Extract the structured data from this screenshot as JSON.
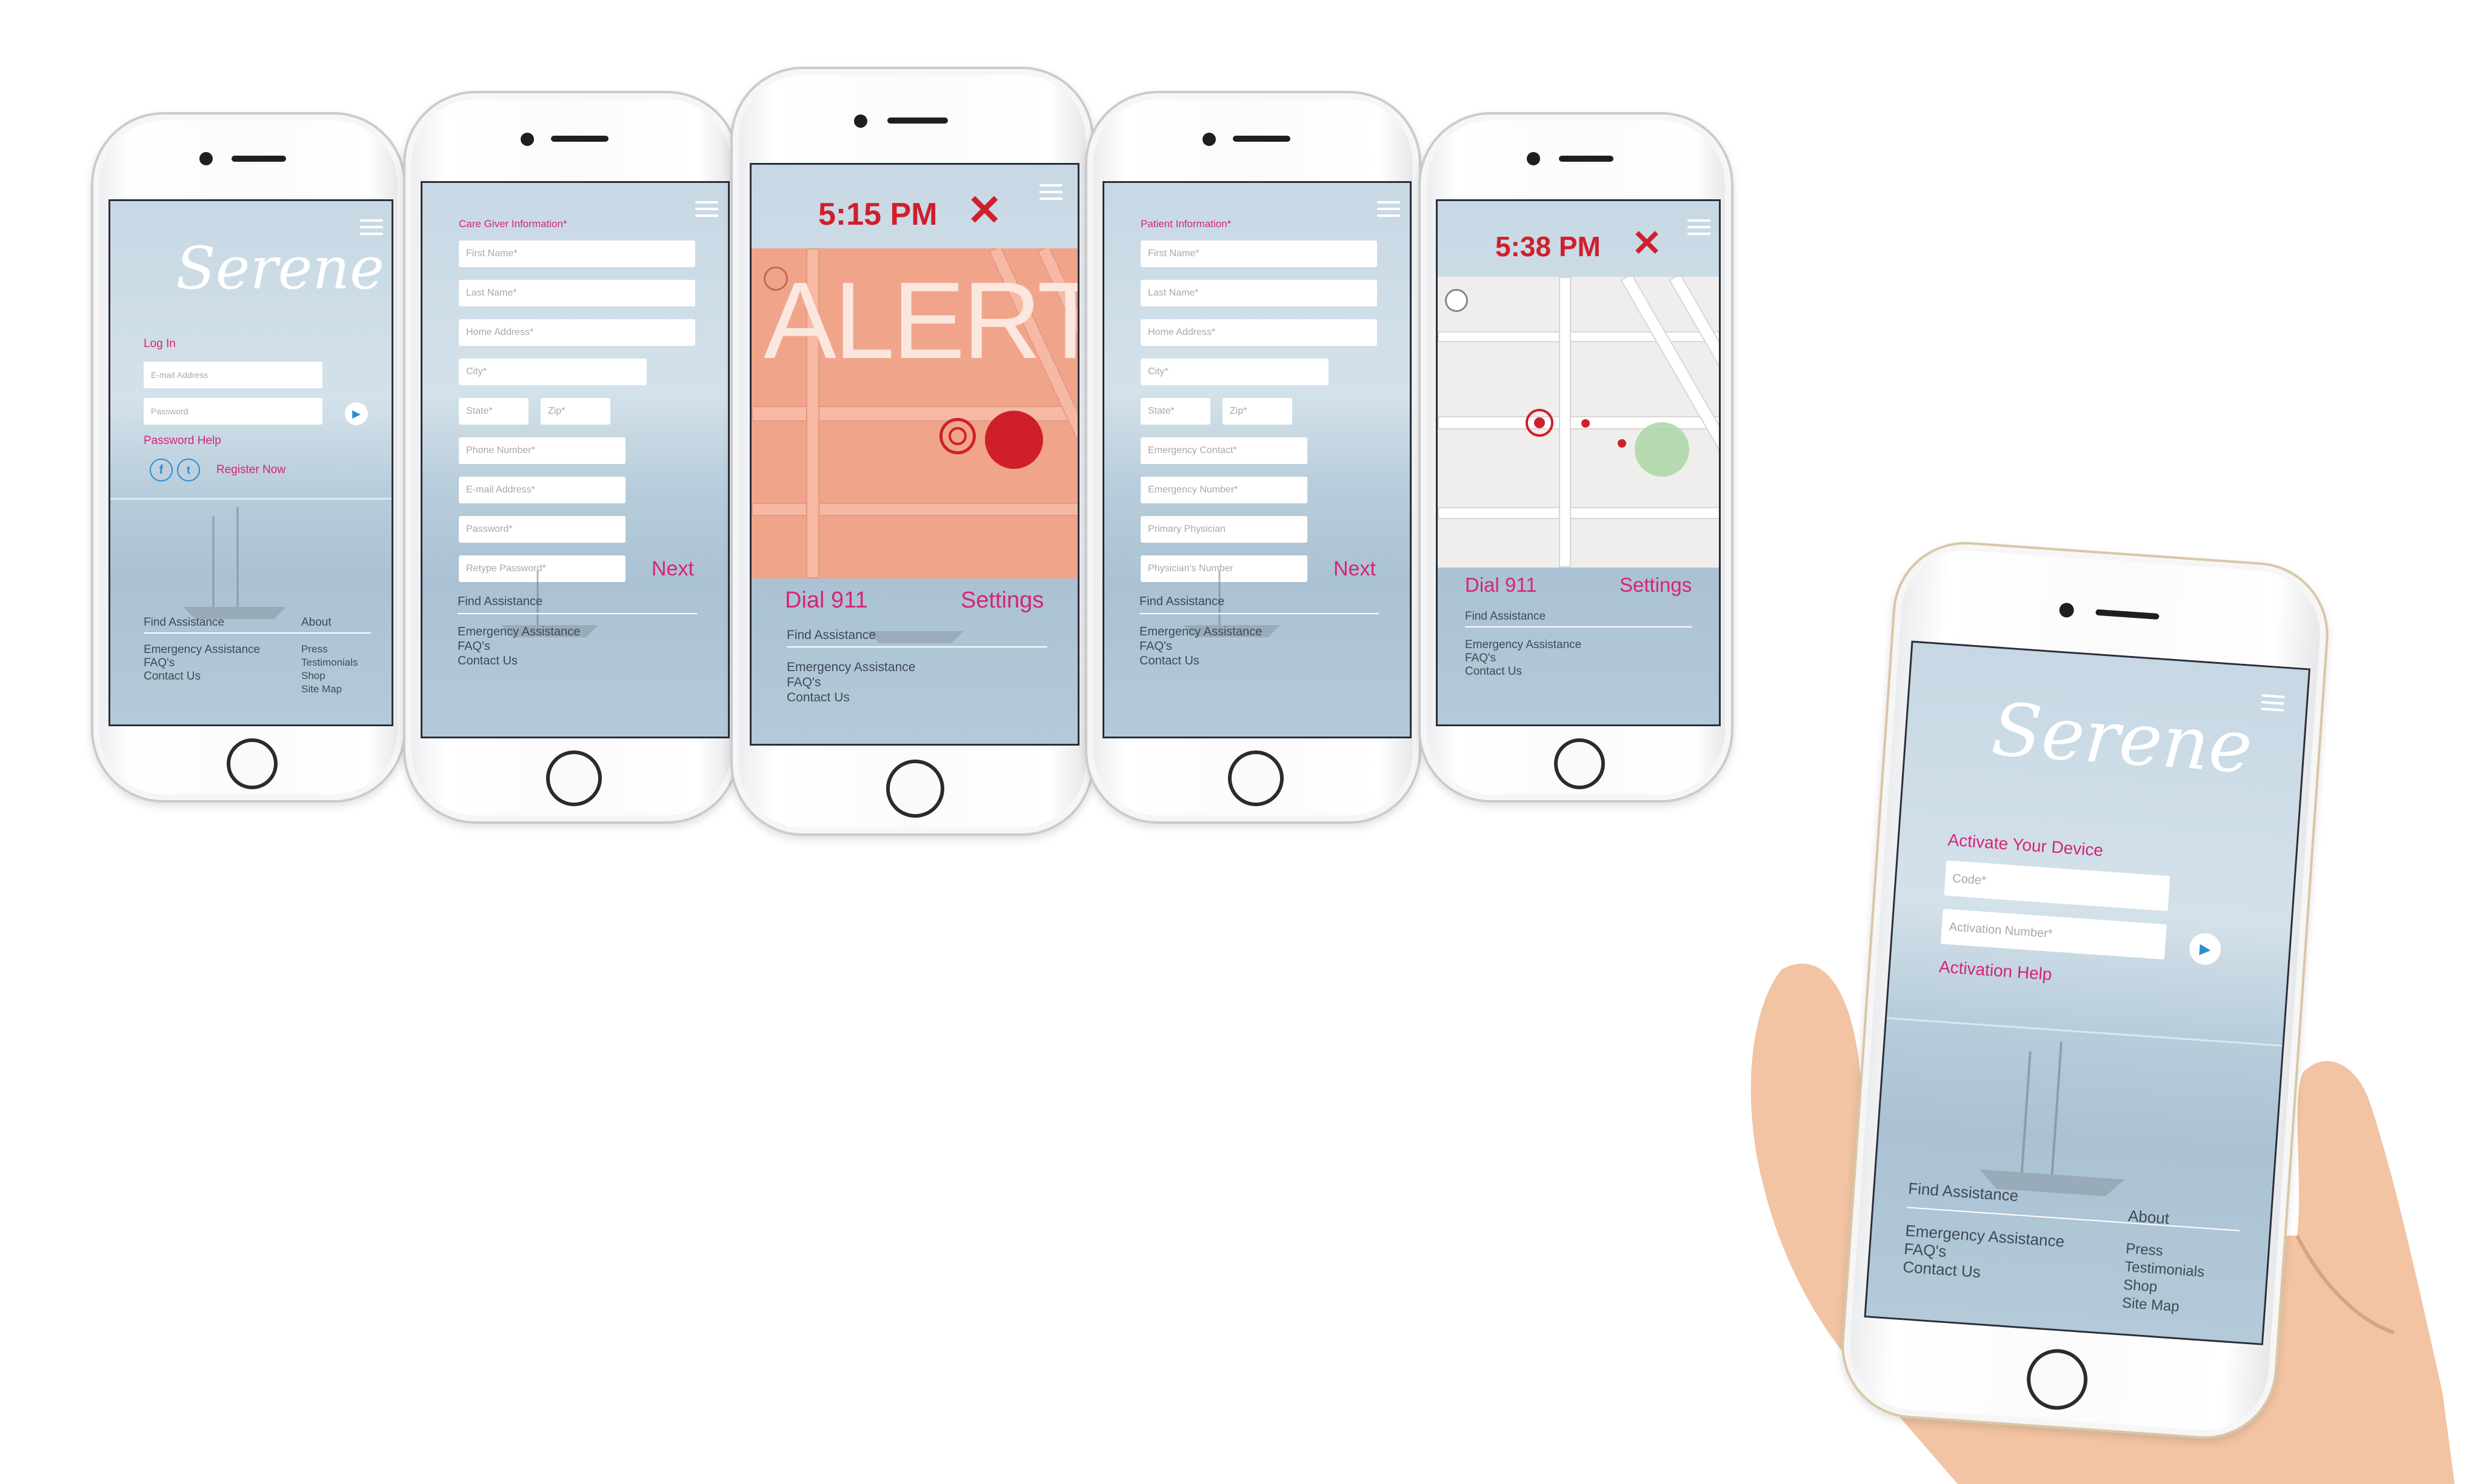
{
  "brand": "Serene",
  "colors": {
    "accent": "#d6247a",
    "alert_red": "#d01f2c",
    "play_blue": "#2a8fd0"
  },
  "icons": [
    "menu-icon",
    "play-icon",
    "facebook-icon",
    "twitter-icon",
    "close-icon",
    "map-pan-icon",
    "location-target-icon"
  ],
  "login": {
    "heading": "Log In",
    "email_placeholder": "E-mail Address",
    "password_placeholder": "Password",
    "password_help": "Password Help",
    "register": "Register Now"
  },
  "footer": {
    "find_assistance": "Find Assistance",
    "about": "About",
    "left_links": [
      "Emergency Assistance",
      "FAQ's",
      "Contact Us"
    ],
    "right_links": [
      "Press",
      "Testimonials",
      "Shop",
      "Site Map"
    ]
  },
  "caregiver": {
    "heading": "Care Giver Information*",
    "fields": [
      "First Name*",
      "Last Name*",
      "Home Address*",
      "City*",
      "State*",
      "Zip*",
      "Phone Number*",
      "E-mail Address*",
      "Password*",
      "Retype Password*"
    ],
    "next": "Next"
  },
  "alert": {
    "time": "5:15 PM",
    "word": "ALERT",
    "dial": "Dial 911",
    "settings": "Settings"
  },
  "patient": {
    "heading": "Patient Information*",
    "fields": [
      "First Name*",
      "Last Name*",
      "Home Address*",
      "City*",
      "State*",
      "Zip*",
      "Emergency Contact*",
      "Emergency Number*",
      "Primary Physician",
      "Physician's Number"
    ],
    "next": "Next"
  },
  "tracking": {
    "time": "5:38 PM",
    "dial": "Dial 911",
    "settings": "Settings"
  },
  "activation": {
    "heading": "Activate Your Device",
    "code_placeholder": "Code*",
    "number_placeholder": "Activation Number*",
    "help": "Activation Help"
  }
}
